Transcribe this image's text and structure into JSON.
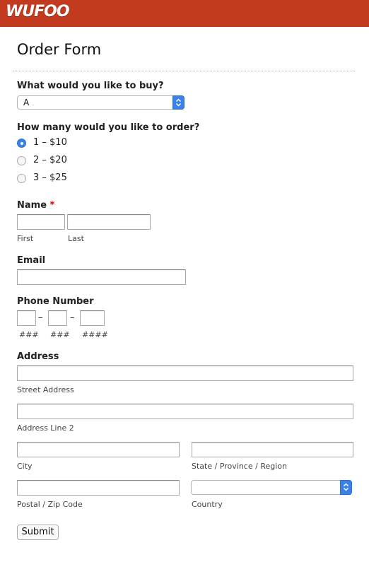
{
  "brand": {
    "logo_text": "WUFOO",
    "accent": "#c23b1e"
  },
  "form": {
    "title": "Order Form",
    "product": {
      "label": "What would you like to buy?",
      "selected": "A"
    },
    "quantity": {
      "label": "How many would you like to order?",
      "options": [
        {
          "label": "1 – $10",
          "checked": true
        },
        {
          "label": "2 – $20",
          "checked": false
        },
        {
          "label": "3 – $25",
          "checked": false
        }
      ]
    },
    "name": {
      "label": "Name",
      "required_mark": "*",
      "first_label": "First",
      "last_label": "Last"
    },
    "email": {
      "label": "Email"
    },
    "phone": {
      "label": "Phone Number",
      "sep": "–",
      "parts": [
        "###",
        "###",
        "####"
      ]
    },
    "address": {
      "label": "Address",
      "street_label": "Street Address",
      "line2_label": "Address Line 2",
      "city_label": "City",
      "state_label": "State / Province / Region",
      "zip_label": "Postal / Zip Code",
      "country_label": "Country",
      "country_selected": ""
    },
    "submit_label": "Submit"
  }
}
